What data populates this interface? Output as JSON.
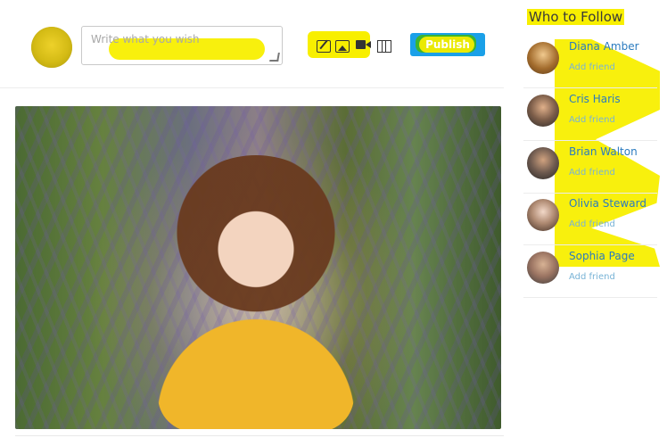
{
  "composer": {
    "placeholder": "Write what you wish",
    "publish_label": "Publish",
    "tools": [
      {
        "name": "edit-icon"
      },
      {
        "name": "image-icon"
      },
      {
        "name": "video-icon"
      },
      {
        "name": "map-icon"
      }
    ]
  },
  "sidebar": {
    "title": "Who to Follow",
    "items": [
      {
        "name": "Diana Amber",
        "action": "Add friend"
      },
      {
        "name": "Cris Haris",
        "action": "Add friend"
      },
      {
        "name": "Brian Walton",
        "action": "Add friend"
      },
      {
        "name": "Olivia Steward",
        "action": "Add friend"
      },
      {
        "name": "Sophia Page",
        "action": "Add friend"
      }
    ]
  }
}
